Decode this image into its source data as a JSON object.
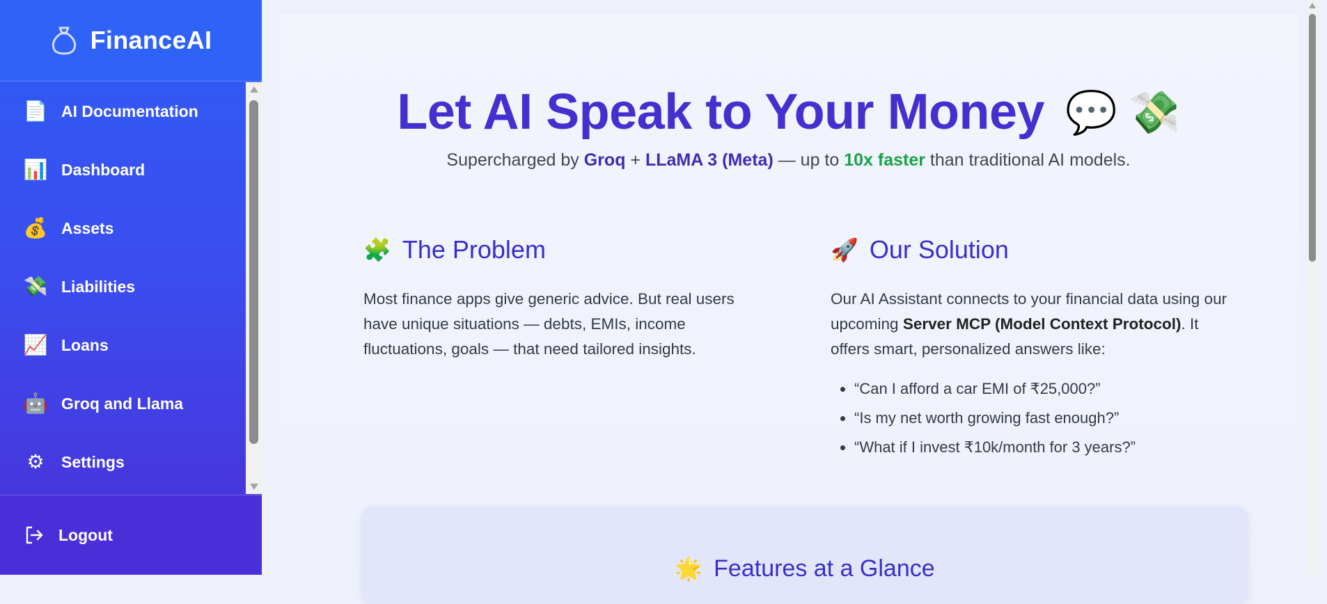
{
  "brand": {
    "name": "FinanceAI",
    "icon": "money-bag-icon"
  },
  "sidebar": {
    "items": [
      {
        "label": "AI Documentation",
        "icon": "document-icon",
        "glyph": "📄"
      },
      {
        "label": "Dashboard",
        "icon": "dashboard-icon",
        "glyph": "📊"
      },
      {
        "label": "Assets",
        "icon": "assets-icon",
        "glyph": "💰"
      },
      {
        "label": "Liabilities",
        "icon": "liabilities-icon",
        "glyph": "💸"
      },
      {
        "label": "Loans",
        "icon": "loans-icon",
        "glyph": "📈"
      },
      {
        "label": "Groq and Llama",
        "icon": "robot-icon",
        "glyph": "🤖"
      },
      {
        "label": "Settings",
        "icon": "gear-icon",
        "glyph": "⚙"
      }
    ],
    "logout_label": "Logout"
  },
  "hero": {
    "title": "Let AI Speak to Your Money",
    "title_emoji": "💬 💸",
    "sub_prefix": "Supercharged by ",
    "sub_groq": "Groq",
    "sub_plus": " + ",
    "sub_llama": "LLaMA 3 (Meta)",
    "sub_mid": " — up to ",
    "sub_fast": "10x faster",
    "sub_suffix": " than traditional AI models."
  },
  "problem": {
    "emoji": "🧩",
    "title": "The Problem",
    "text": "Most finance apps give generic advice. But real users have unique situations — debts, EMIs, income fluctuations, goals — that need tailored insights."
  },
  "solution": {
    "emoji": "🚀",
    "title": "Our Solution",
    "text_prefix": "Our AI Assistant connects to your financial data using our upcoming ",
    "text_bold": "Server MCP (Model Context Protocol)",
    "text_suffix": ". It offers smart, personalized answers like:",
    "examples": [
      "“Can I afford a car EMI of ₹25,000?”",
      "“Is my net worth growing fast enough?”",
      "“What if I invest ₹10k/month for 3 years?”"
    ]
  },
  "features": {
    "emoji": "🌟",
    "title": "Features at a Glance"
  },
  "colors": {
    "sidebar_top": "#2f5cf5",
    "sidebar_bottom": "#4b2fd6",
    "heading": "#4330cf",
    "accent_green": "#17a34a"
  }
}
